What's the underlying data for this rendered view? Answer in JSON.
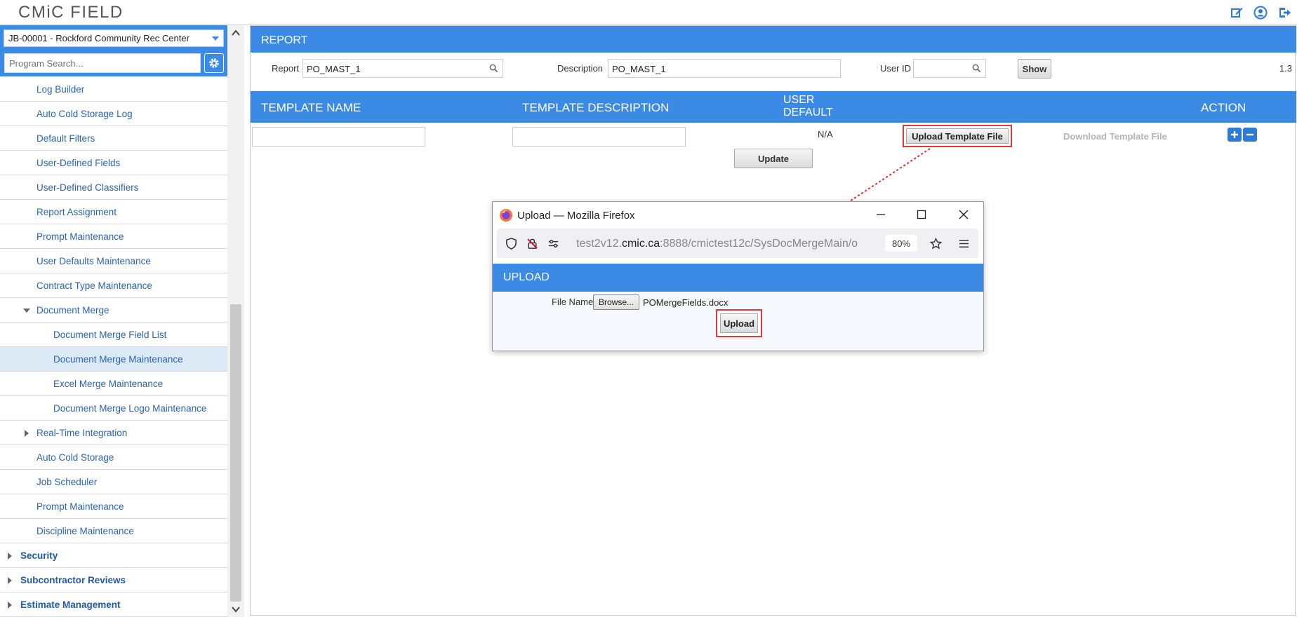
{
  "app": {
    "logo": "CMiC FIELD"
  },
  "topbar": {
    "icons": [
      "edit-icon",
      "user-profile-icon",
      "logout-icon"
    ]
  },
  "sidebar": {
    "job_selected": "JB-00001 - Rockford Community Rec Center",
    "search_placeholder": "Program Search...",
    "items": [
      {
        "label": "Log Builder",
        "level": 1
      },
      {
        "label": "Auto Cold Storage Log",
        "level": 1
      },
      {
        "label": "Default Filters",
        "level": 1
      },
      {
        "label": "User-Defined Fields",
        "level": 1
      },
      {
        "label": "User-Defined Classifiers",
        "level": 1
      },
      {
        "label": "Report Assignment",
        "level": 1
      },
      {
        "label": "Prompt Maintenance",
        "level": 1
      },
      {
        "label": "User Defaults Maintenance",
        "level": 1
      },
      {
        "label": "Contract Type Maintenance",
        "level": 1
      },
      {
        "label": "Document Merge",
        "level": 1,
        "expanded": true
      },
      {
        "label": "Document Merge Field List",
        "level": 2
      },
      {
        "label": "Document Merge Maintenance",
        "level": 2,
        "selected": true
      },
      {
        "label": "Excel Merge Maintenance",
        "level": 2
      },
      {
        "label": "Document Merge Logo Maintenance",
        "level": 2
      },
      {
        "label": "Real-Time Integration",
        "level": 1,
        "collapsed": true
      },
      {
        "label": "Auto Cold Storage",
        "level": 1
      },
      {
        "label": "Job Scheduler",
        "level": 1
      },
      {
        "label": "Prompt Maintenance",
        "level": 1
      },
      {
        "label": "Discipline Maintenance",
        "level": 1
      },
      {
        "label": "Security",
        "level": 0
      },
      {
        "label": "Subcontractor Reviews",
        "level": 0
      },
      {
        "label": "Estimate Management",
        "level": 0
      }
    ]
  },
  "report": {
    "header": "REPORT",
    "report_label": "Report",
    "report_value": "PO_MAST_1",
    "description_label": "Description",
    "description_value": "PO_MAST_1",
    "userid_label": "User ID",
    "userid_value": "",
    "show_label": "Show",
    "version": "1.3"
  },
  "templates": {
    "columns": [
      "TEMPLATE NAME",
      "TEMPLATE DESCRIPTION",
      "USER",
      "DEFAULT",
      "ACTION"
    ],
    "row": {
      "template_name": "",
      "template_description": "",
      "user_default": "N/A",
      "upload_label": "Upload Template File",
      "download_label": "Download Template File"
    },
    "update_label": "Update"
  },
  "popup": {
    "title": "Upload — Mozilla Firefox",
    "url_prefix": "test2v12.",
    "url_domain": "cmic.ca",
    "url_rest": ":8888/cmictest12c/SysDocMergeMain/o",
    "zoom": "80%",
    "header": "UPLOAD",
    "file_name_label": "File Name",
    "browse_label": "Browse...",
    "file_name_value": "POMergeFields.docx",
    "upload_label": "Upload"
  },
  "colors": {
    "accent_blue": "#3b8ae6",
    "highlight_red": "#e0393b",
    "link_blue": "#2a64b0"
  }
}
